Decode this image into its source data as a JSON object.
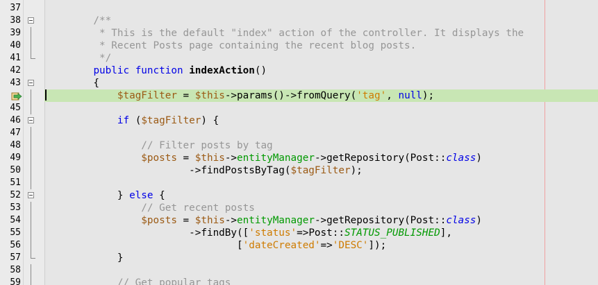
{
  "editor": {
    "lines": [
      {
        "num": "37",
        "fold": "",
        "segs": []
      },
      {
        "num": "38",
        "fold": "open",
        "segs": [
          {
            "t": "    /**",
            "c": "cm"
          }
        ]
      },
      {
        "num": "39",
        "fold": "line",
        "segs": [
          {
            "t": "     * This is the default \"index\" action of the controller. It displays the",
            "c": "cm"
          }
        ]
      },
      {
        "num": "40",
        "fold": "line",
        "segs": [
          {
            "t": "     * Recent Posts page containing the recent blog posts.",
            "c": "cm"
          }
        ]
      },
      {
        "num": "41",
        "fold": "end",
        "segs": [
          {
            "t": "     */",
            "c": "cm"
          }
        ]
      },
      {
        "num": "42",
        "fold": "",
        "segs": [
          {
            "t": "    ",
            "c": ""
          },
          {
            "t": "public",
            "c": "kw"
          },
          {
            "t": " ",
            "c": ""
          },
          {
            "t": "function",
            "c": "kw"
          },
          {
            "t": " ",
            "c": ""
          },
          {
            "t": "indexAction",
            "c": "b"
          },
          {
            "t": "()",
            "c": ""
          }
        ]
      },
      {
        "num": "43",
        "fold": "open",
        "segs": [
          {
            "t": "    {",
            "c": ""
          }
        ]
      },
      {
        "num": "",
        "fold": "line",
        "highlight": true,
        "segs": [
          {
            "t": "        ",
            "c": ""
          },
          {
            "t": "$tagFilter",
            "c": "var"
          },
          {
            "t": " = ",
            "c": ""
          },
          {
            "t": "$this",
            "c": "var"
          },
          {
            "t": "->params()->fromQuery(",
            "c": ""
          },
          {
            "t": "'tag'",
            "c": "str"
          },
          {
            "t": ", ",
            "c": ""
          },
          {
            "t": "null",
            "c": "kw"
          },
          {
            "t": ");",
            "c": ""
          }
        ]
      },
      {
        "num": "45",
        "fold": "line",
        "segs": []
      },
      {
        "num": "46",
        "fold": "open",
        "segs": [
          {
            "t": "        ",
            "c": ""
          },
          {
            "t": "if",
            "c": "kw"
          },
          {
            "t": " (",
            "c": ""
          },
          {
            "t": "$tagFilter",
            "c": "var"
          },
          {
            "t": ") {",
            "c": ""
          }
        ]
      },
      {
        "num": "47",
        "fold": "line",
        "segs": []
      },
      {
        "num": "48",
        "fold": "line",
        "segs": [
          {
            "t": "            // Filter posts by tag",
            "c": "cm"
          }
        ]
      },
      {
        "num": "49",
        "fold": "line",
        "segs": [
          {
            "t": "            ",
            "c": ""
          },
          {
            "t": "$posts",
            "c": "var"
          },
          {
            "t": " = ",
            "c": ""
          },
          {
            "t": "$this",
            "c": "var"
          },
          {
            "t": "->",
            "c": ""
          },
          {
            "t": "entityManager",
            "c": "fld"
          },
          {
            "t": "->getRepository(Post::",
            "c": ""
          },
          {
            "t": "class",
            "c": "kw i"
          },
          {
            "t": ")",
            "c": ""
          }
        ]
      },
      {
        "num": "50",
        "fold": "line",
        "segs": [
          {
            "t": "                    ->findPostsByTag(",
            "c": ""
          },
          {
            "t": "$tagFilter",
            "c": "var"
          },
          {
            "t": ");",
            "c": ""
          }
        ]
      },
      {
        "num": "51",
        "fold": "line",
        "segs": []
      },
      {
        "num": "52",
        "fold": "open",
        "segs": [
          {
            "t": "        } ",
            "c": ""
          },
          {
            "t": "else",
            "c": "kw"
          },
          {
            "t": " {",
            "c": ""
          }
        ]
      },
      {
        "num": "53",
        "fold": "line",
        "segs": [
          {
            "t": "            // Get recent posts",
            "c": "cm"
          }
        ]
      },
      {
        "num": "54",
        "fold": "line",
        "segs": [
          {
            "t": "            ",
            "c": ""
          },
          {
            "t": "$posts",
            "c": "var"
          },
          {
            "t": " = ",
            "c": ""
          },
          {
            "t": "$this",
            "c": "var"
          },
          {
            "t": "->",
            "c": ""
          },
          {
            "t": "entityManager",
            "c": "fld"
          },
          {
            "t": "->getRepository(Post::",
            "c": ""
          },
          {
            "t": "class",
            "c": "kw i"
          },
          {
            "t": ")",
            "c": ""
          }
        ]
      },
      {
        "num": "55",
        "fold": "line",
        "segs": [
          {
            "t": "                    ->findBy([",
            "c": ""
          },
          {
            "t": "'status'",
            "c": "str"
          },
          {
            "t": "=>Post::",
            "c": ""
          },
          {
            "t": "STATUS_PUBLISHED",
            "c": "fld-i"
          },
          {
            "t": "],",
            "c": ""
          }
        ]
      },
      {
        "num": "56",
        "fold": "line",
        "segs": [
          {
            "t": "                            [",
            "c": ""
          },
          {
            "t": "'dateCreated'",
            "c": "str"
          },
          {
            "t": "=>",
            "c": ""
          },
          {
            "t": "'DESC'",
            "c": "str"
          },
          {
            "t": "]);",
            "c": ""
          }
        ]
      },
      {
        "num": "57",
        "fold": "end",
        "segs": [
          {
            "t": "        }",
            "c": ""
          }
        ]
      },
      {
        "num": "58",
        "fold": "line",
        "segs": []
      },
      {
        "num": "59",
        "fold": "line",
        "segs": [
          {
            "t": "        // Get popular tags",
            "c": "cm"
          }
        ]
      }
    ],
    "colors": {
      "highlight": "#c8e6b4",
      "keyword": "#0000e6",
      "comment": "#969696",
      "variable": "#9b5a14",
      "string": "#ce7b00",
      "field": "#009900"
    },
    "gutter_icon": "current-line-arrow-icon"
  }
}
